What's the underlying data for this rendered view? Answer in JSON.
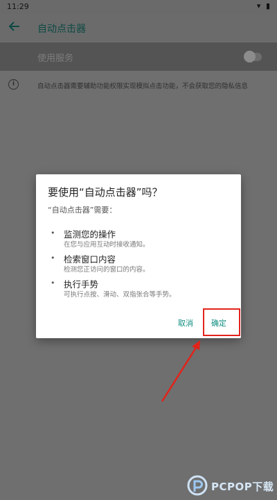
{
  "status_bar": {
    "time": "11:29",
    "icons": "▾ ▮"
  },
  "app_bar": {
    "title": "自动点击器"
  },
  "service": {
    "label": "使用服务"
  },
  "info": {
    "text": "自动点击器需要辅助功能权限实现模拟点击功能，不会获取您的隐私信息"
  },
  "dialog": {
    "title": "要使用“自动点击器”吗？",
    "subtitle": "“自动点击器”需要：",
    "permissions": [
      {
        "title": "监测您的操作",
        "desc": "在您与应用互动时接收通知。"
      },
      {
        "title": "检索窗口内容",
        "desc": "检测您正访问的窗口的内容。"
      },
      {
        "title": "执行手势",
        "desc": "可执行点按、滑动、双指张合等手势。"
      }
    ],
    "cancel_label": "取消",
    "ok_label": "确定"
  },
  "watermark": {
    "text": "PCPOP下载"
  },
  "colors": {
    "accent": "#0f8f80",
    "highlight": "#e2231a"
  }
}
